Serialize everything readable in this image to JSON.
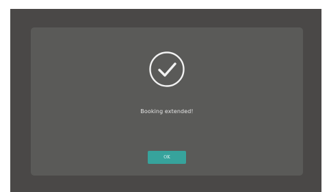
{
  "dialog": {
    "message": "Booking extended!",
    "icon": "check-circle-icon",
    "ok_label": "OK"
  },
  "colors": {
    "backdrop": "#4a4847",
    "dialog": "#5a5a58",
    "accent": "#37a39c"
  }
}
